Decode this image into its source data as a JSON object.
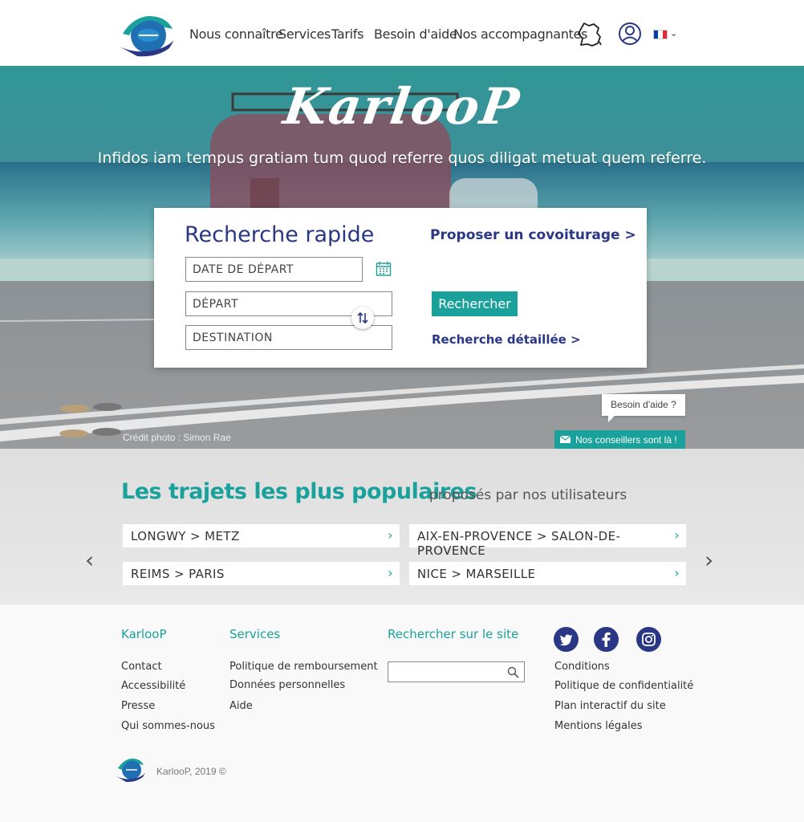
{
  "header": {
    "logo_text": "KarlooP",
    "nav": [
      "Nous connaître",
      "Services",
      "Tarifs",
      "Besoin d'aide",
      "Nos accompagnantes"
    ],
    "language": "FR",
    "icons": [
      "france-map-icon",
      "user-icon",
      "flag-fr-icon",
      "chevron-down-icon"
    ]
  },
  "hero": {
    "brand": "KarlooP",
    "tagline": "Infidos iam tempus gratiam tum quod referre quos  diligat metuat quem referre.",
    "credit": "Crédit photo : Simon Rae"
  },
  "search": {
    "title": "Recherche rapide",
    "date_placeholder": "DATE DE DÉPART",
    "from_placeholder": "DÉPART",
    "to_placeholder": "DESTINATION",
    "propose": "Proposer un covoiturage >",
    "submit": "Rechercher",
    "detailed": "Recherche détaillée >"
  },
  "help": {
    "bubble": "Besoin d'aide ?",
    "advisors": "Nos conseillers sont là !"
  },
  "popular": {
    "title": "Les trajets les plus populaires",
    "subtitle": "proposés par nos utilisateurs",
    "routes": [
      "LONGWY > METZ",
      "AIX-EN-PROVENCE > SALON-DE-PROVENCE",
      "REIMS > PARIS",
      "NICE > MARSEILLE"
    ],
    "prev": "‹",
    "next": "›"
  },
  "footer": {
    "col1": {
      "title": "KarlooP",
      "links": [
        "Contact",
        "Accessibilité",
        "Presse",
        "Qui sommes-nous"
      ]
    },
    "col2": {
      "title": "Services",
      "links": [
        "Politique de remboursement",
        "Données personnelles",
        "Aide"
      ]
    },
    "col3": {
      "title": "Rechercher sur le site"
    },
    "col4": {
      "links": [
        "Conditions",
        "Politique de confidentialité",
        "Plan interactif du site",
        "Mentions légales"
      ]
    },
    "social": [
      "twitter-icon",
      "facebook-icon",
      "instagram-icon"
    ],
    "copyright": "KarlooP, 2019 ©"
  },
  "colors": {
    "teal": "#1aa19b",
    "navy": "#2a3785"
  }
}
